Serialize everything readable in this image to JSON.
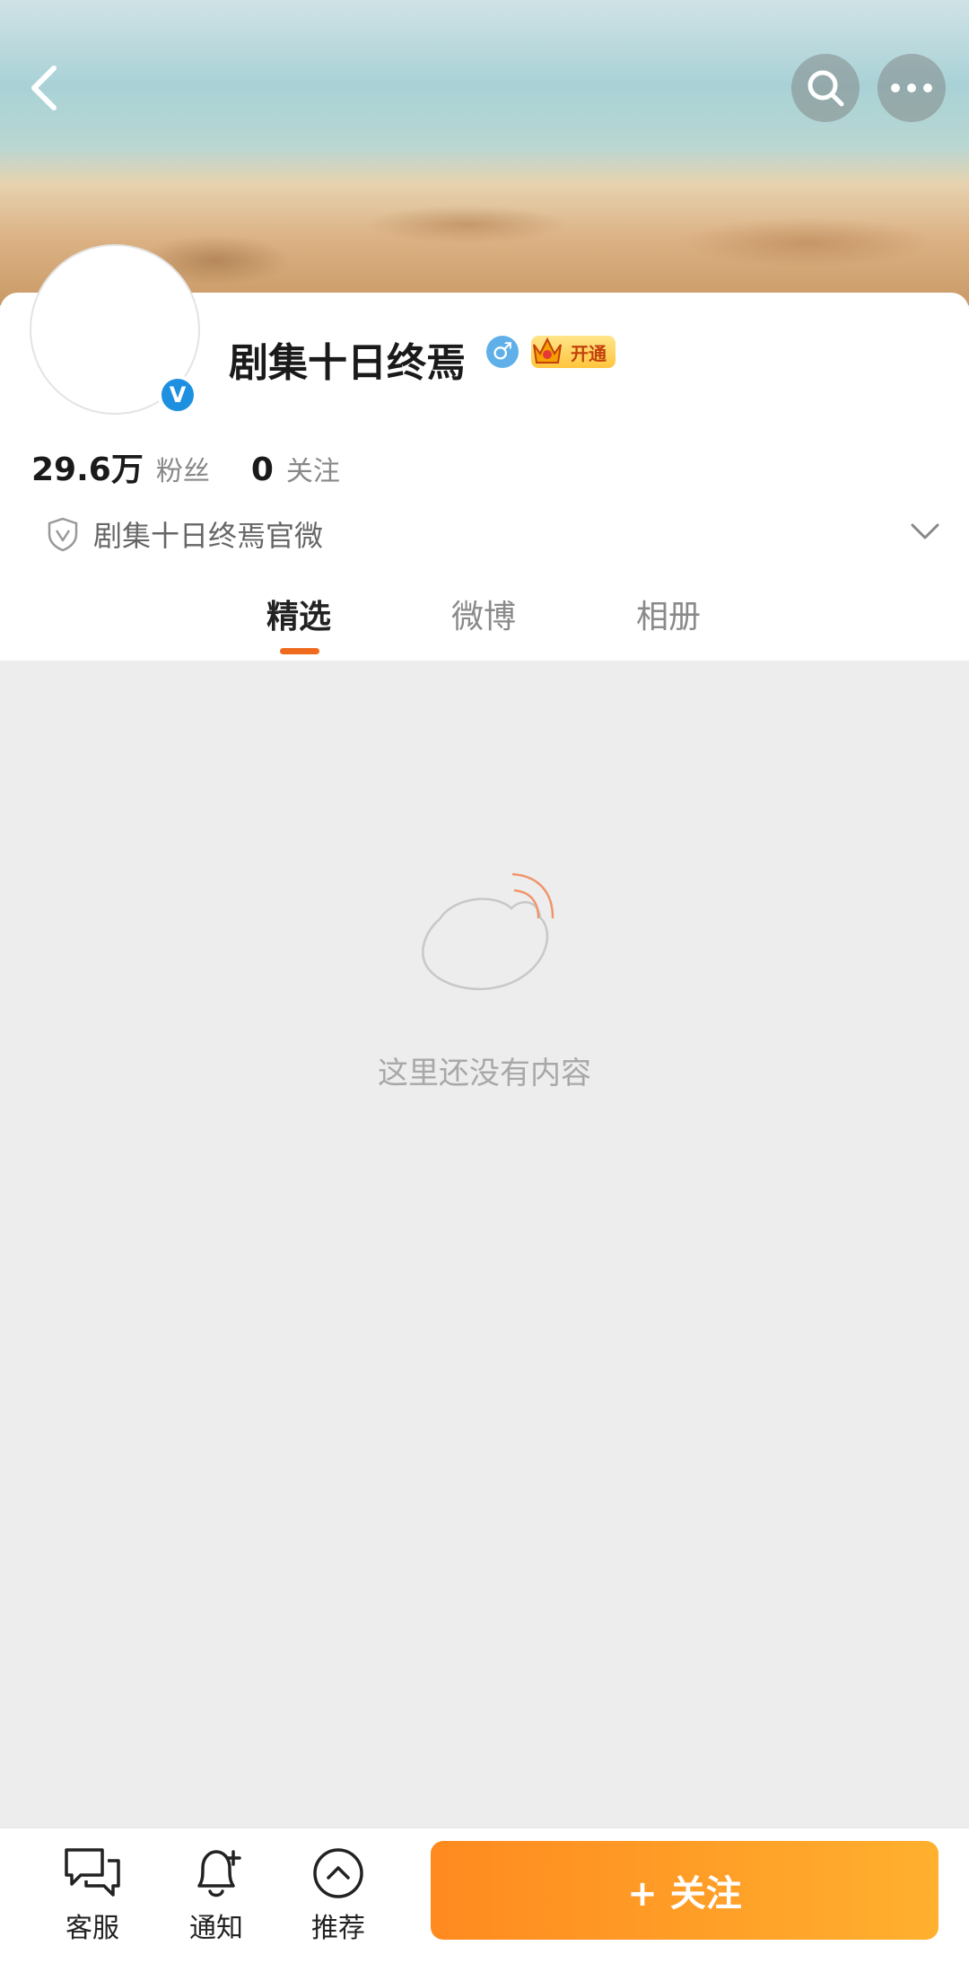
{
  "profile": {
    "name": "剧集十日终焉",
    "verified_mark": "V",
    "gender_icon": "male-icon",
    "vip_label": "开通",
    "followers_count": "29.6万",
    "followers_label": "粉丝",
    "following_count": "0",
    "following_label": "关注",
    "description": "剧集十日终焉官微"
  },
  "tabs": [
    {
      "label": "精选",
      "active": true
    },
    {
      "label": "微博",
      "active": false
    },
    {
      "label": "相册",
      "active": false
    }
  ],
  "empty_state": {
    "message": "这里还没有内容"
  },
  "bottom_bar": {
    "items": [
      {
        "label": "客服",
        "icon": "chat-bubbles-icon"
      },
      {
        "label": "通知",
        "icon": "bell-plus-icon"
      },
      {
        "label": "推荐",
        "icon": "chevron-up-circle-icon"
      }
    ],
    "follow_label": "+ 关注"
  },
  "colors": {
    "accent": "#f06a1d",
    "follow_start": "#ff8a1f",
    "follow_end": "#ffb02e",
    "verified": "#1e90e0"
  }
}
